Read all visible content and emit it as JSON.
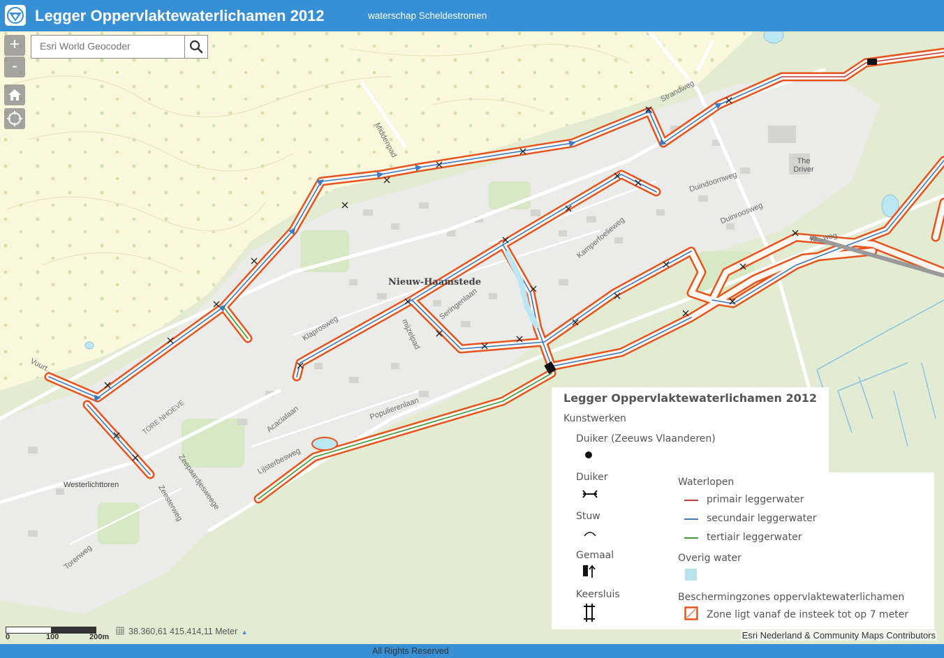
{
  "header": {
    "title": "Legger Oppervlaktewaterlichamen 2012",
    "subtitle": "waterschap Scheldestromen",
    "color": "#3790d6"
  },
  "controls": {
    "zoom_in": "+",
    "zoom_out": "-",
    "home_icon": "home-icon",
    "locate_icon": "locate-icon"
  },
  "search": {
    "placeholder": "Esri World Geocoder",
    "button_icon": "search-icon"
  },
  "map": {
    "labels": {
      "strandweg": "Strandweg",
      "middenpad": "Middenpad",
      "the_driver": "The Driver",
      "duindoornweg": "Duindoornweg",
      "duinroosweg": "Duinroosweg",
      "kamperfoelieweg": "Kamperfoelieweg",
      "nieuw_haamstede": "Nieuw-Haamstede",
      "seringenlaan": "Seringenlaan",
      "klaprosweg": "Klaprosweg",
      "mijzelpad": "mijzelpad",
      "vuurtoren": "Vuurt...",
      "tore_nhoeve": "TORE NHOEVE",
      "acacialaan": "Acacialaan",
      "populierenlaan": "Populierenlaan",
      "lijsterbesweg": "Lijsterbesweg",
      "westerlichttoren": "Westerlichttoren",
      "zeepaardjesweg": "Zeepaardjesweege",
      "zeesterweg": "Zeesterweg",
      "torenweg": "Torenweg",
      "kl_weg": "Kl...weg"
    },
    "colors": {
      "zone": "#e8531c",
      "primair": "#c03a3a",
      "secundair": "#3d7ac2",
      "tertiair": "#3d9a3d",
      "overig_water": "#b5e4ee"
    }
  },
  "legend": {
    "title": "Legger Oppervlaktewaterlichamen 2012",
    "kunstwerken_heading": "Kunstwerken",
    "items_left": [
      {
        "label": "Duiker (Zeeuws Vlaanderen)",
        "icon": "dot-icon"
      },
      {
        "label": "Duiker",
        "icon": "duiker-icon"
      },
      {
        "label": "Stuw",
        "icon": "stuw-icon"
      },
      {
        "label": "Gemaal",
        "icon": "gemaal-icon"
      },
      {
        "label": "Keersluis",
        "icon": "keersluis-icon"
      }
    ],
    "waterlopen_heading": "Waterlopen",
    "waterlopen": [
      {
        "label": "primair leggerwater",
        "color": "#c03a3a"
      },
      {
        "label": "secundair leggerwater",
        "color": "#3d7ac2"
      },
      {
        "label": "tertiair leggerwater",
        "color": "#3d9a3d"
      }
    ],
    "overig_water_heading": "Overig water",
    "overig_water_color": "#b5e4ee",
    "beschermingszones_heading": "Beschermingzones oppervlaktewaterlichamen",
    "zone_label": "Zone ligt vanaf de insteek tot op 7 meter",
    "zone_color": "#e8531c"
  },
  "scalebar": {
    "labels": [
      "0",
      "100",
      "200m"
    ]
  },
  "coordinates": {
    "text": "38.360,61  415.414,11 Meter",
    "icon": "coordinates-icon"
  },
  "attribution": "Esri Nederland & Community Maps Contributors",
  "footer": {
    "text": "All Rights Reserved"
  }
}
